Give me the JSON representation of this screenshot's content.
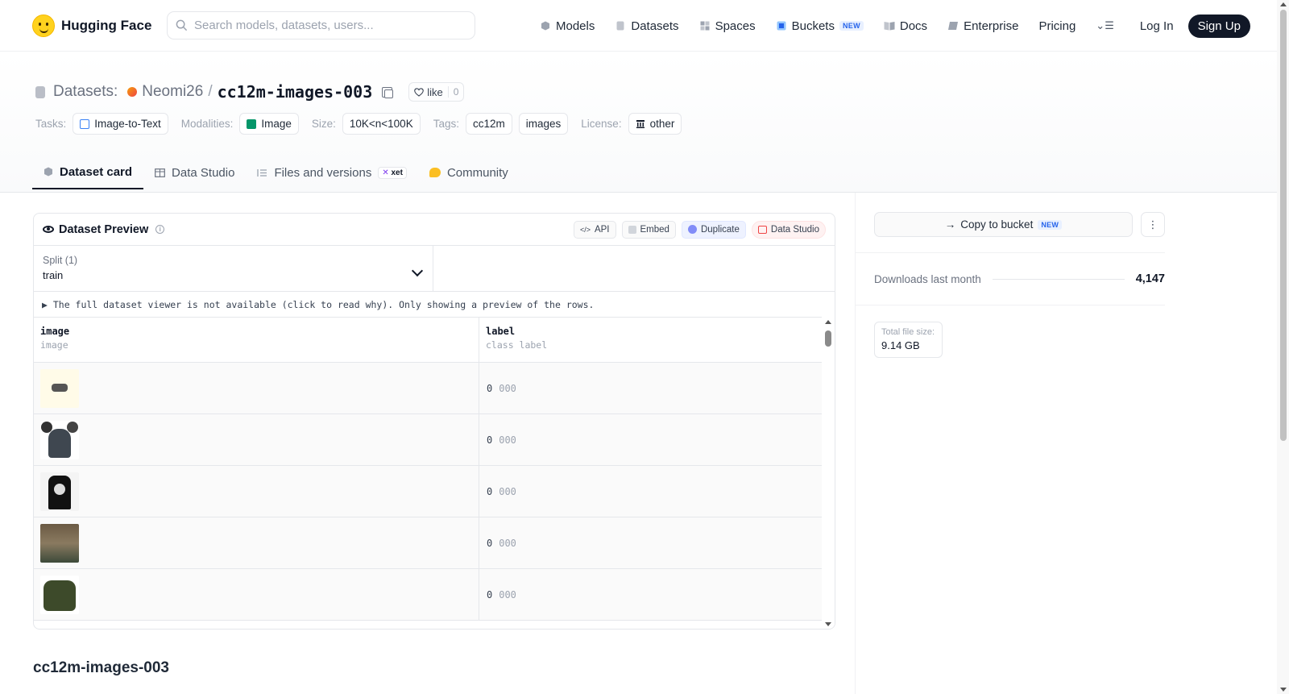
{
  "header": {
    "brand": "Hugging Face",
    "search_placeholder": "Search models, datasets, users...",
    "nav": [
      {
        "label": "Models",
        "icon": "models-icon"
      },
      {
        "label": "Datasets",
        "icon": "datasets-icon"
      },
      {
        "label": "Spaces",
        "icon": "spaces-icon"
      },
      {
        "label": "Buckets",
        "icon": "buckets-icon",
        "badge": "NEW"
      },
      {
        "label": "Docs",
        "icon": "docs-icon"
      },
      {
        "label": "Enterprise",
        "icon": "enterprise-icon"
      },
      {
        "label": "Pricing"
      }
    ],
    "login": "Log In",
    "signup": "Sign Up"
  },
  "repo": {
    "section_label": "Datasets:",
    "owner": "Neomi26",
    "separator": "/",
    "name": "cc12m-images-003",
    "like_label": "like",
    "like_count": "0"
  },
  "meta": {
    "tasks_label": "Tasks:",
    "task": "Image-to-Text",
    "modalities_label": "Modalities:",
    "modality": "Image",
    "size_label": "Size:",
    "size": "10K<n<100K",
    "tags_label": "Tags:",
    "tags": [
      "cc12m",
      "images"
    ],
    "license_label": "License:",
    "license": "other"
  },
  "tabs": [
    {
      "label": "Dataset card",
      "active": true
    },
    {
      "label": "Data Studio"
    },
    {
      "label": "Files and versions",
      "badge": "xet"
    },
    {
      "label": "Community"
    }
  ],
  "preview": {
    "title": "Dataset Preview",
    "buttons": {
      "api": "API",
      "embed": "Embed",
      "duplicate": "Duplicate",
      "data_studio": "Data Studio"
    },
    "split_label": "Split (1)",
    "split_value": "train",
    "notice": "▶ The full dataset viewer is not available (click to read why). Only showing a preview of the rows.",
    "columns": [
      {
        "name": "image",
        "type": "image"
      },
      {
        "name": "label",
        "type": "class label"
      }
    ],
    "rows": [
      {
        "label_id": "0",
        "label_name": "000"
      },
      {
        "label_id": "0",
        "label_name": "000"
      },
      {
        "label_id": "0",
        "label_name": "000"
      },
      {
        "label_id": "0",
        "label_name": "000"
      },
      {
        "label_id": "0",
        "label_name": "000"
      }
    ]
  },
  "card_title": "cc12m-images-003",
  "sidebar": {
    "bucket_label": "Copy to bucket",
    "bucket_badge": "NEW",
    "downloads_label": "Downloads last month",
    "downloads_value": "4,147",
    "filesize_label": "Total file size:",
    "filesize_value": "9.14 GB"
  }
}
